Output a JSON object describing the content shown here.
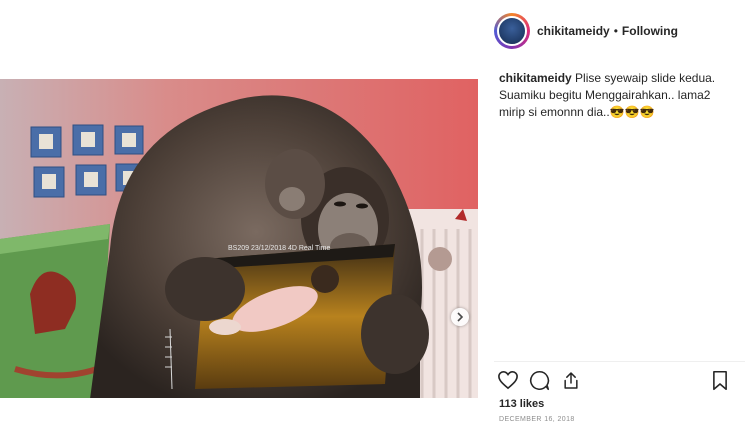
{
  "header": {
    "username": "chikitameidy",
    "separator": "•",
    "follow_status": "Following"
  },
  "post": {
    "photo_overlay_text": "BS209    23/12/2018    4D Real Time",
    "next_icon": "chevron-right-icon"
  },
  "caption": {
    "username": "chikitameidy",
    "text": "Plise syewaip slide kedua. Suamiku begitu Menggairahkan.. lama2 mirip si emonnn dia..😎😎😎"
  },
  "actions": {
    "like_icon": "heart-icon",
    "comment_icon": "comment-icon",
    "share_icon": "share-icon",
    "save_icon": "bookmark-icon"
  },
  "likes": "113 likes",
  "date": "DECEMBER 16, 2018"
}
